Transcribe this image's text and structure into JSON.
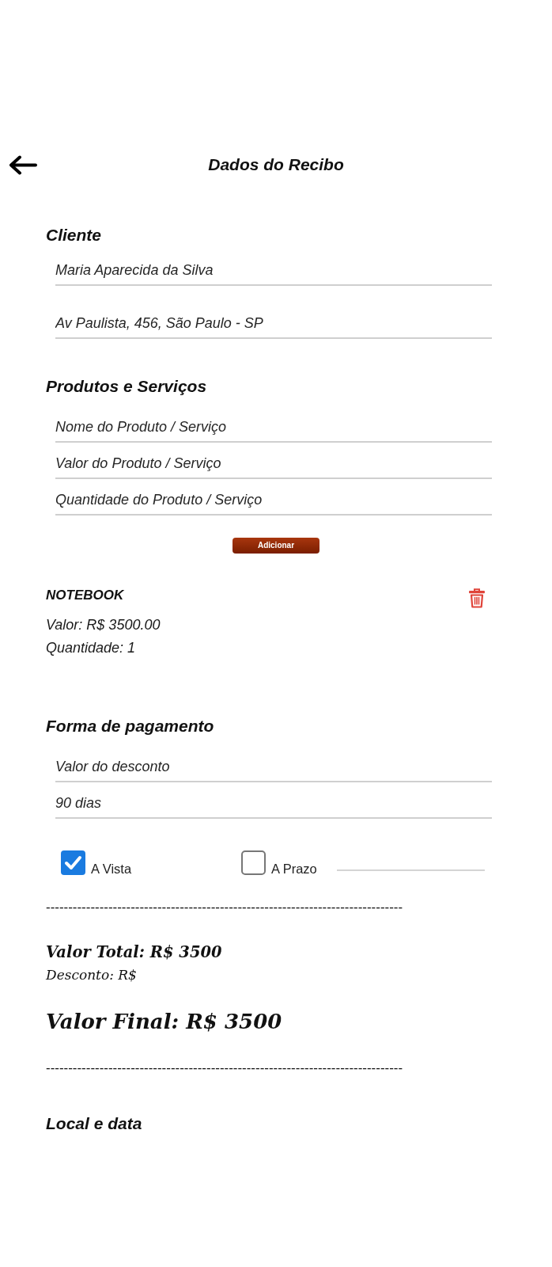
{
  "header": {
    "title": "Dados do Recibo"
  },
  "client": {
    "title": "Cliente",
    "fields": [
      {
        "value": "Maria Aparecida da Silva"
      },
      {
        "value": "Av Paulista, 456, São Paulo - SP"
      }
    ]
  },
  "products": {
    "title": "Produtos e Serviços",
    "fields": [
      {
        "placeholder": "Nome do Produto / Serviço"
      },
      {
        "placeholder": "Valor do Produto / Serviço"
      },
      {
        "placeholder": "Quantidade do Produto / Serviço"
      }
    ],
    "add_button": "Adicionar",
    "items": [
      {
        "name": "NOTEBOOK",
        "price": "Valor: R$ 3500.00",
        "quantity": "Quantidade: 1"
      }
    ]
  },
  "payment": {
    "title": "Forma de pagamento",
    "fields": [
      {
        "placeholder": "Valor do desconto"
      },
      {
        "value": "90 dias"
      }
    ],
    "options": [
      {
        "label": "A Vista",
        "checked": true,
        "kind": "plain"
      },
      {
        "label": "A Prazo",
        "checked": false,
        "kind": "with_field"
      }
    ]
  },
  "summary": {
    "lines": [
      {
        "kind": "divider",
        "text": "--------------------------------------------------------------------------------"
      },
      {
        "kind": "total",
        "text": "Valor Total: R$ 3500"
      },
      {
        "kind": "discount",
        "text": "Desconto: R$"
      },
      {
        "kind": "final",
        "text": "Valor Final: R$ 3500"
      },
      {
        "kind": "divider",
        "text": "--------------------------------------------------------------------------------"
      }
    ]
  },
  "place_date": {
    "title": "Local e data"
  }
}
